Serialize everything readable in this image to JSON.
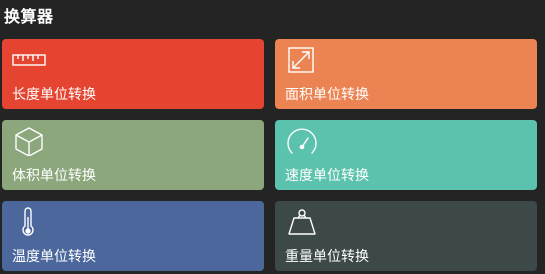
{
  "header": {
    "title": "换算器"
  },
  "tiles": [
    {
      "label": "长度单位转换",
      "icon": "ruler-icon",
      "color": "#e54530"
    },
    {
      "label": "面积单位转换",
      "icon": "expand-diagonal-icon",
      "color": "#ec8352"
    },
    {
      "label": "体积单位转换",
      "icon": "cube-icon",
      "color": "#8da77c"
    },
    {
      "label": "速度单位转换",
      "icon": "speedometer-icon",
      "color": "#5bc2ae"
    },
    {
      "label": "温度单位转换",
      "icon": "thermometer-icon",
      "color": "#4b679c"
    },
    {
      "label": "重量单位转换",
      "icon": "weight-icon",
      "color": "#3d4848"
    }
  ]
}
